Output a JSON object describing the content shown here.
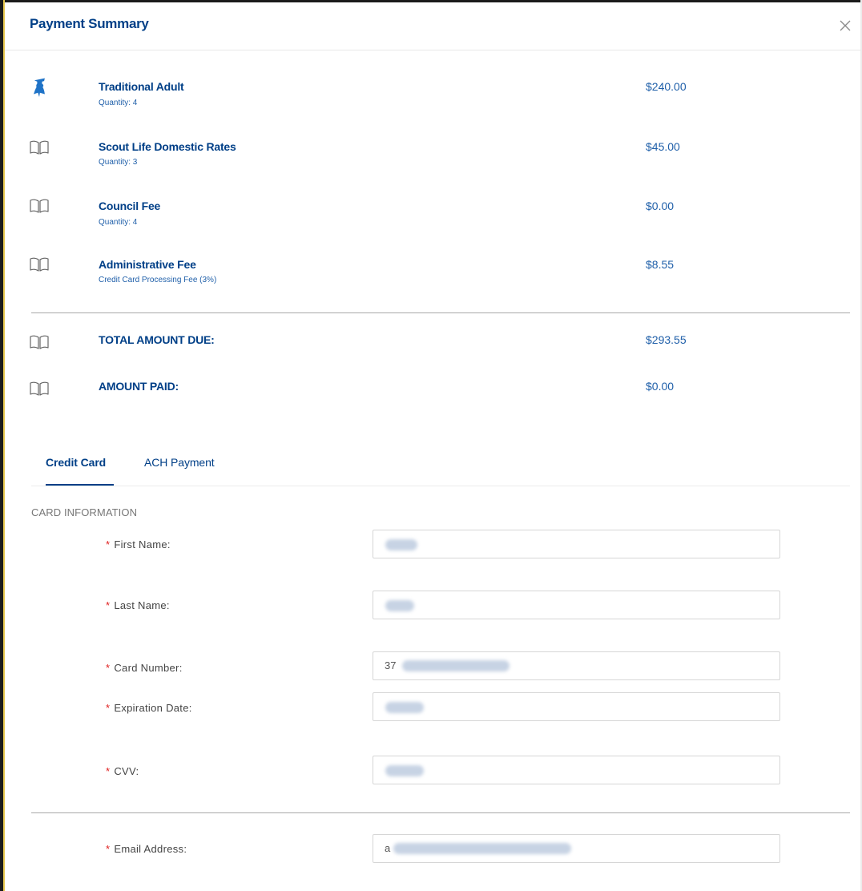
{
  "modal": {
    "title": "Payment Summary",
    "close_icon": "close-icon"
  },
  "items": [
    {
      "name": "Traditional Adult",
      "sub": "Quantity: 4",
      "amount": "$240.00",
      "icon": "scout-silhouette-icon"
    },
    {
      "name": "Scout Life Domestic Rates",
      "sub": "Quantity: 3",
      "amount": "$45.00",
      "icon": "book-icon"
    },
    {
      "name": "Council Fee",
      "sub": "Quantity: 4",
      "amount": "$0.00",
      "icon": "book-icon"
    },
    {
      "name": "Administrative Fee",
      "sub": "Credit Card Processing Fee (3%)",
      "amount": "$8.55",
      "icon": "book-icon"
    }
  ],
  "totals": [
    {
      "label": "TOTAL AMOUNT DUE:",
      "amount": "$293.55",
      "icon": "book-icon"
    },
    {
      "label": "AMOUNT PAID:",
      "amount": "$0.00",
      "icon": "book-icon"
    }
  ],
  "tabs": [
    {
      "label": "Credit Card",
      "active": true
    },
    {
      "label": "ACH Payment",
      "active": false
    }
  ],
  "card_section": {
    "title": "CARD INFORMATION",
    "fields": [
      {
        "label": "First Name",
        "required": true
      },
      {
        "label": "Last Name",
        "required": true
      },
      {
        "label": "Card Number",
        "required": true,
        "visible_prefix": "37"
      },
      {
        "label": "Expiration Date",
        "required": true
      },
      {
        "label": "CVV",
        "required": true
      }
    ]
  },
  "email_field": {
    "label": "Email Address",
    "required": true,
    "visible_prefix": "a"
  },
  "colors": {
    "brand_navy": "#003f87",
    "link_blue": "#1f5fa9",
    "required_red": "#e02020",
    "divider": "#a9a9a9"
  }
}
